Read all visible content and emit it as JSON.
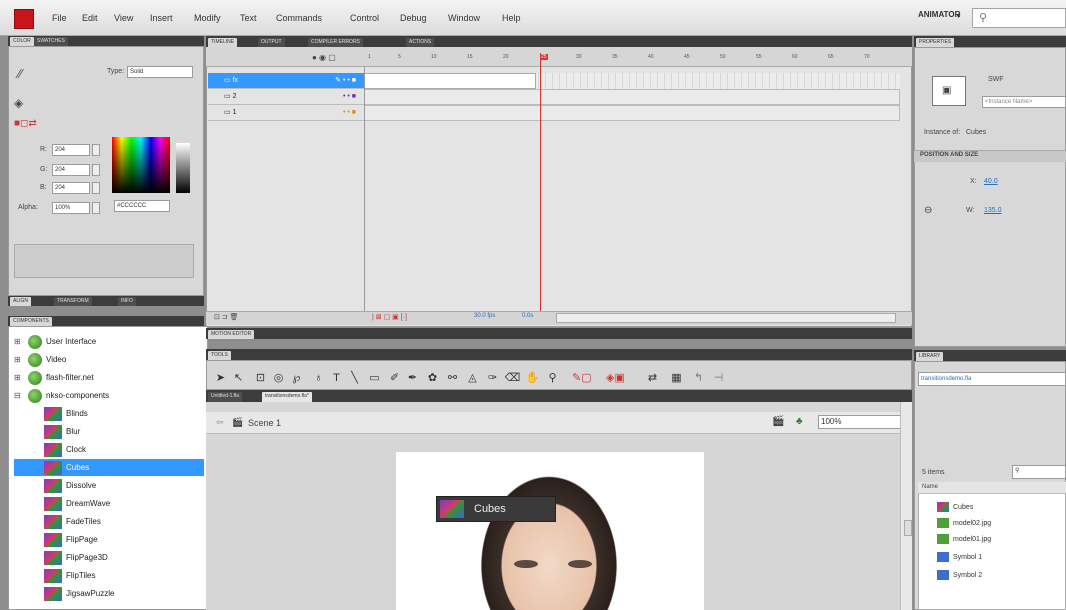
{
  "menu": [
    "File",
    "Edit",
    "View",
    "Insert",
    "Modify",
    "Text",
    "Commands",
    "Control",
    "Debug",
    "Window",
    "Help"
  ],
  "workspace": "ANIMATOR",
  "workspace_arrow": "▼",
  "search_glyph": "⚲",
  "color_panel": {
    "tabs": [
      "COLOR",
      "SWATCHES"
    ],
    "type_label": "Type:",
    "type_value": "Solid",
    "r_label": "R:",
    "r_value": "204",
    "g_label": "G:",
    "g_value": "204",
    "b_label": "B:",
    "b_value": "204",
    "alpha_label": "Alpha:",
    "alpha_value": "100%",
    "hex_value": "#CCCCCC"
  },
  "align_tabs": [
    "ALIGN",
    "TRANSFORM",
    "INFO"
  ],
  "components": {
    "title": "COMPONENTS",
    "folders": [
      "User Interface",
      "Video",
      "flash-filter.net",
      "nkso-components"
    ],
    "items": [
      "Blinds",
      "Blur",
      "Clock",
      "Cubes",
      "Dissolve",
      "DreamWave",
      "FadeTiles",
      "FlipPage",
      "FlipPage3D",
      "FlipTiles",
      "JigsawPuzzle"
    ],
    "selected": "Cubes"
  },
  "timeline": {
    "tabs": [
      "TIMELINE",
      "OUTPUT",
      "COMPILER ERRORS",
      "ACTIONS"
    ],
    "ruler": [
      "1",
      "5",
      "10",
      "15",
      "20",
      "25",
      "30",
      "35",
      "40",
      "45",
      "50",
      "55",
      "60",
      "65",
      "70"
    ],
    "layers": [
      "fx",
      "2",
      "1"
    ],
    "fps": "30.0 fps",
    "time": "0.0s"
  },
  "motion_editor": "MOTION EDITOR",
  "tools_title": "TOOLS",
  "doc_tabs": [
    "Untitled-1.fla",
    "transitionsdemo.fla*"
  ],
  "scene": "Scene 1",
  "zoom": "100%",
  "tooltip": "Cubes",
  "properties": {
    "title": "PROPERTIES",
    "kind": "SWF",
    "instance_placeholder": "<Instance Name>",
    "instance_of_label": "Instance of:",
    "instance_of_value": "Cubes",
    "section": "POSITION AND SIZE",
    "x_label": "X:",
    "x_value": "40.0",
    "w_label": "W:",
    "w_value": "135.0"
  },
  "library": {
    "title": "LIBRARY",
    "file": "transitionsdemo.fla",
    "count": "5 items",
    "name_header": "Name",
    "items": [
      "Cubes",
      "model02.jpg",
      "model01.jpg",
      "Symbol 1",
      "Symbol 2"
    ]
  },
  "colors": {
    "accent": "#3399ff",
    "playhead": "#e03030",
    "logo": "#c8141a"
  }
}
